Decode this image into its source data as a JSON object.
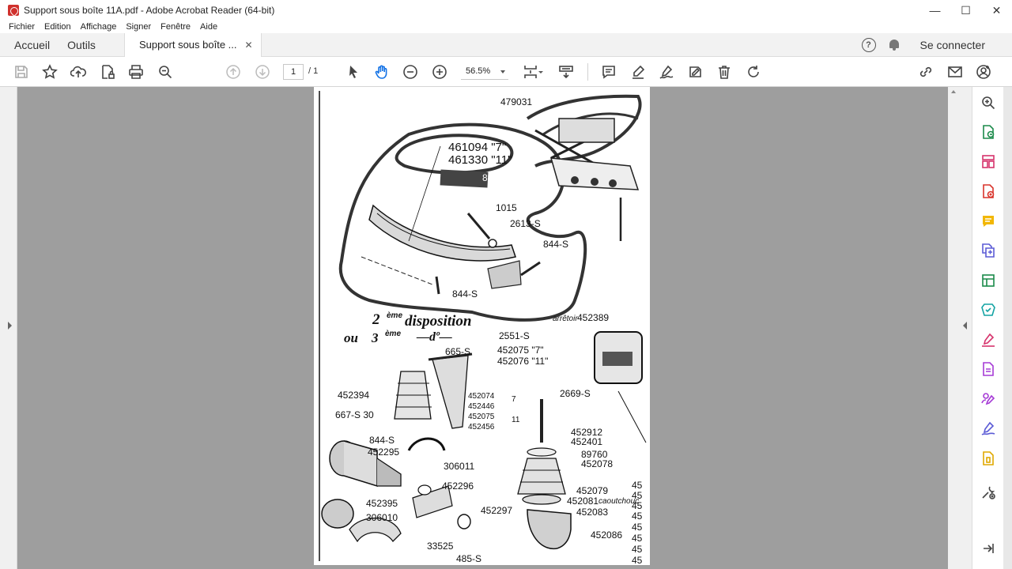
{
  "window": {
    "title": "Support sous boîte 11A.pdf - Adobe Acrobat Reader (64-bit)",
    "minimize": "—",
    "maximize": "☐",
    "close": "✕"
  },
  "menu": [
    "Fichier",
    "Edition",
    "Affichage",
    "Signer",
    "Fenêtre",
    "Aide"
  ],
  "tabs": {
    "home": "Accueil",
    "tools": "Outils",
    "document": "Support sous boîte ...",
    "close": "✕",
    "help": "?",
    "signin": "Se connecter"
  },
  "toolbar": {
    "page_current": "1",
    "page_total": "/ 1",
    "zoom": "56.5%",
    "icons": [
      "save-icon",
      "star-icon",
      "upload-icon",
      "lock-file-icon",
      "print-icon",
      "zoom-search-icon",
      "page-up-icon",
      "page-down-icon",
      "select-arrow-icon",
      "hand-icon",
      "zoom-out-icon",
      "zoom-in-icon",
      "fit-page-icon",
      "scroll-mode-icon",
      "comment-icon",
      "highlight-pen-icon",
      "sign-icon",
      "fill-sign-icon",
      "delete-icon",
      "rotate-icon",
      "share-link-icon",
      "email-icon",
      "add-user-icon"
    ]
  },
  "sidebar": {
    "icons": [
      "search-zoom-icon",
      "export-pdf-icon",
      "organize-pages-icon",
      "create-pdf-icon",
      "comment-icon",
      "combine-files-icon",
      "edit-pdf-icon",
      "scan-icon",
      "fill-sign-icon",
      "pdf-file-icon",
      "request-sign-icon",
      "sign-pen-icon",
      "compress-icon",
      "tools-icon",
      "collapse-icon"
    ]
  },
  "drawing": {
    "labels": [
      "479031",
      "461094 \"7\"",
      "461330 \"11\"",
      "88850",
      "1015",
      "2613-S",
      "844-S",
      "844-S",
      "arrêtoir",
      "452389",
      "2551-S",
      "665-S",
      "452075 \"7\"",
      "452076 \"11\"",
      "2669-S",
      "452394",
      "667-S 30",
      "452074",
      "452446",
      "452075",
      "452456",
      "7",
      "11",
      "452912",
      "452401",
      "844-S",
      "452295",
      "306011",
      "89760",
      "452078",
      "452296",
      "452079",
      "452081",
      "caoutchouc",
      "452083",
      "452395",
      "306010",
      "452297",
      "452086",
      "33525",
      "485-S",
      "45",
      "45",
      "45",
      "45",
      "45",
      "45",
      "45",
      "45"
    ],
    "title_2": "2",
    "title_3": "3",
    "title_eme": "ème",
    "title_eme2": "ème",
    "title_disposition": "disposition",
    "title_ou": "ou",
    "title_do": "—dº—"
  }
}
